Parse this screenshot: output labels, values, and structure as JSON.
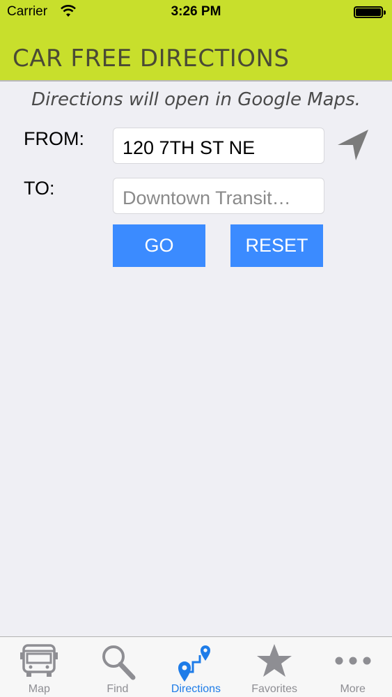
{
  "status_bar": {
    "carrier": "Carrier",
    "time": "3:26 PM"
  },
  "header": {
    "title": "CAR FREE DIRECTIONS"
  },
  "notice": "Directions will open in Google Maps.",
  "form": {
    "from_label": "FROM:",
    "from_value": "120 7TH ST NE",
    "to_label": "TO:",
    "to_placeholder": "Downtown Transit…",
    "go_label": "GO",
    "reset_label": "RESET"
  },
  "tabs": [
    {
      "label": "Map",
      "icon": "bus-icon"
    },
    {
      "label": "Find",
      "icon": "search-icon"
    },
    {
      "label": "Directions",
      "icon": "route-pin-icon",
      "active": true
    },
    {
      "label": "Favorites",
      "icon": "star-icon"
    },
    {
      "label": "More",
      "icon": "more-dots-icon"
    }
  ],
  "colors": {
    "header": "#c8df2c",
    "button": "#3b8bff",
    "active_tab": "#1e7ce8",
    "background": "#efeff4"
  }
}
